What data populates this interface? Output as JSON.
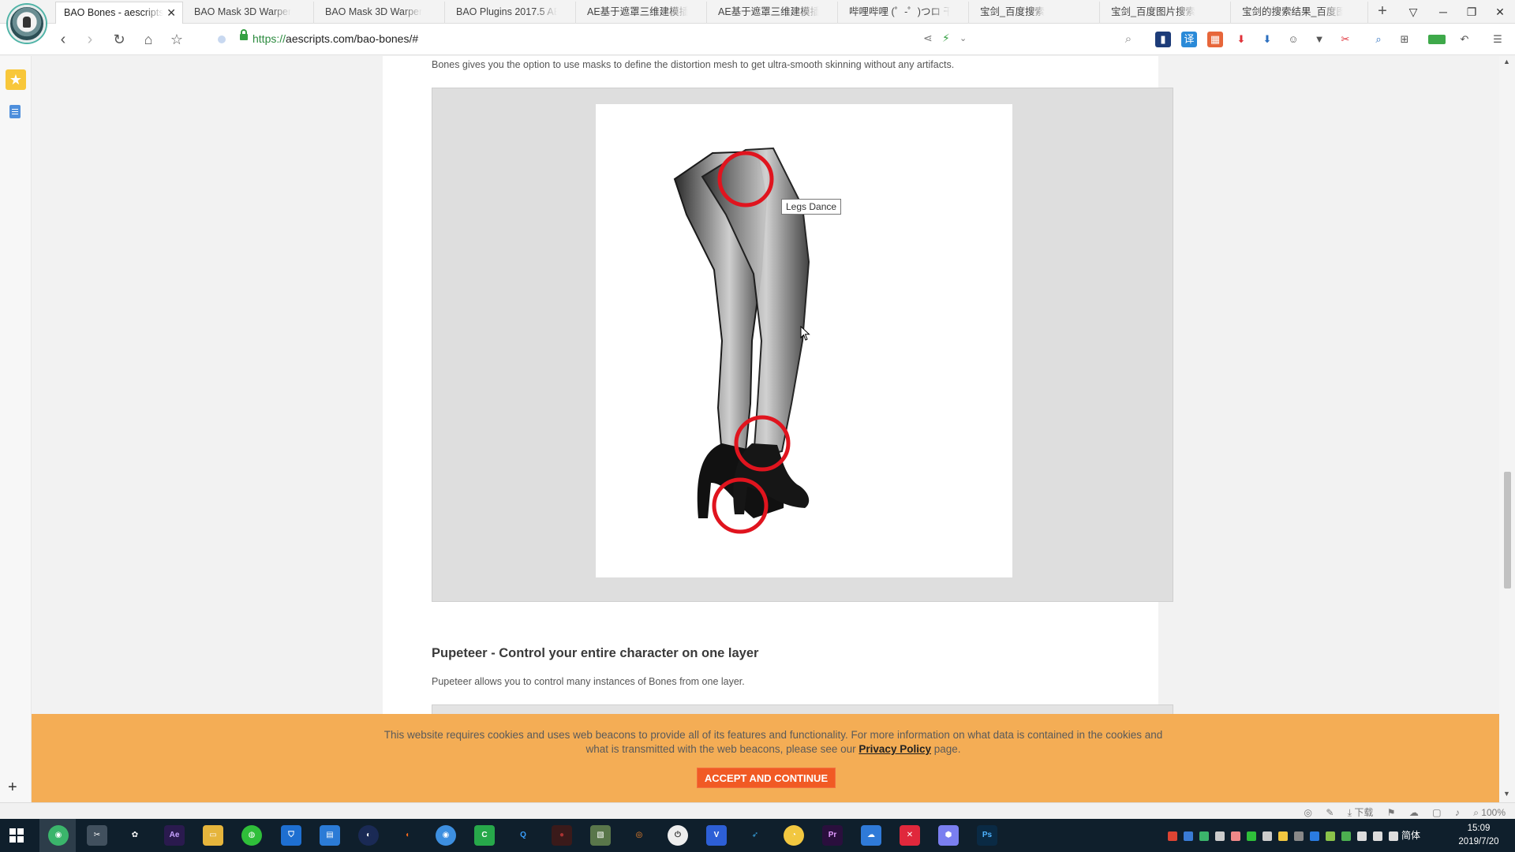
{
  "browser": {
    "tabs": [
      {
        "title": "BAO Bones - aescripts",
        "active": true
      },
      {
        "title": "BAO Mask 3D Warper",
        "active": false
      },
      {
        "title": "BAO Mask 3D Warper",
        "active": false
      },
      {
        "title": "BAO Plugins 2017.5 AE",
        "active": false
      },
      {
        "title": "AE基于遮罩三维建模插件",
        "active": false
      },
      {
        "title": "AE基于遮罩三维建模插件",
        "active": false
      },
      {
        "title": "哔哩哔哩 (゜-゜)つロ 干杯",
        "active": false
      },
      {
        "title": "宝剑_百度搜索",
        "active": false
      },
      {
        "title": "宝剑_百度图片搜索",
        "active": false
      },
      {
        "title": "宝剑的搜索结果_百度图片",
        "active": false
      }
    ],
    "url": {
      "scheme": "https://",
      "rest": "aescripts.com/bao-bones/#"
    },
    "zoom": "100%",
    "download_label": "下载"
  },
  "page": {
    "intro": "Bones gives you the option to use masks to define the distortion mesh to get ultra-smooth skinning without any artifacts.",
    "figure_tooltip": "Legs Dance",
    "section_title": "Pupeteer - Control your entire character on one layer",
    "section_text": "Pupeteer allows you to control many instances of Bones from one layer."
  },
  "cookie_banner": {
    "text_before": "This website requires cookies and uses web beacons to provide all of its features and functionality. For more information on what data is contained in the cookies and what is transmitted with the web beacons, please see our ",
    "link": "Privacy Policy",
    "text_after": " page.",
    "button": "ACCEPT AND CONTINUE"
  },
  "taskbar": {
    "ime": "简体",
    "time": "15:09",
    "date": "2019/7/20"
  },
  "colors": {
    "banner": "#f4ad55",
    "accept_button": "#f15a24",
    "marker_circle": "#e0141e",
    "secure_green": "#35a043"
  }
}
